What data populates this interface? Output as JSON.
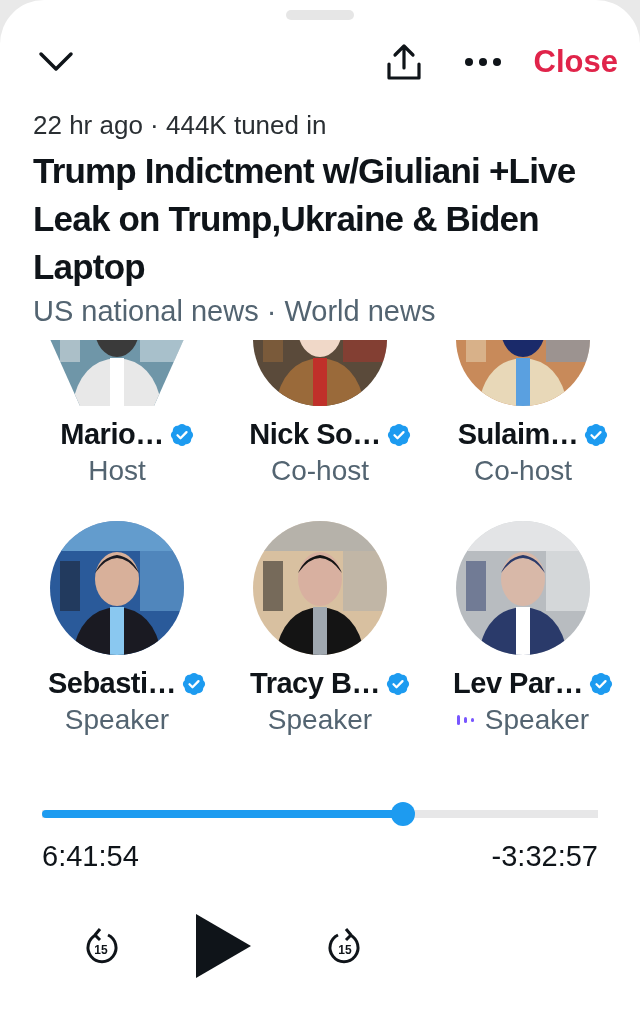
{
  "header": {
    "close_label": "Close"
  },
  "space": {
    "meta": "22 hr ago · 444K tuned in",
    "title": "Trump Indictment w/Giuliani +Live Leak on Trump,Ukraine & Biden Laptop",
    "topics": "US national news · World news"
  },
  "participants": [
    {
      "name": "Mario…",
      "role": "Host",
      "verified": true,
      "speaking": false,
      "avatar": {
        "kind": "hexagon"
      }
    },
    {
      "name": "Nick So…",
      "role": "Co-host",
      "verified": true,
      "speaking": false,
      "avatar": {
        "kind": "circle"
      }
    },
    {
      "name": "Sulaim…",
      "role": "Co-host",
      "verified": true,
      "speaking": false,
      "avatar": {
        "kind": "circle"
      }
    },
    {
      "name": "Sebasti…",
      "role": "Speaker",
      "verified": true,
      "speaking": false,
      "avatar": {
        "kind": "circle"
      }
    },
    {
      "name": "Tracy B…",
      "role": "Speaker",
      "verified": true,
      "speaking": false,
      "avatar": {
        "kind": "circle"
      }
    },
    {
      "name": "Lev Par…",
      "role": "Speaker",
      "verified": true,
      "speaking": true,
      "avatar": {
        "kind": "circle"
      }
    }
  ],
  "player": {
    "level": 0.65,
    "elapsed": "6:41:54",
    "remaining": "-3:32:57",
    "rewind_label": "15",
    "forward_label": "15",
    "playing": false
  }
}
